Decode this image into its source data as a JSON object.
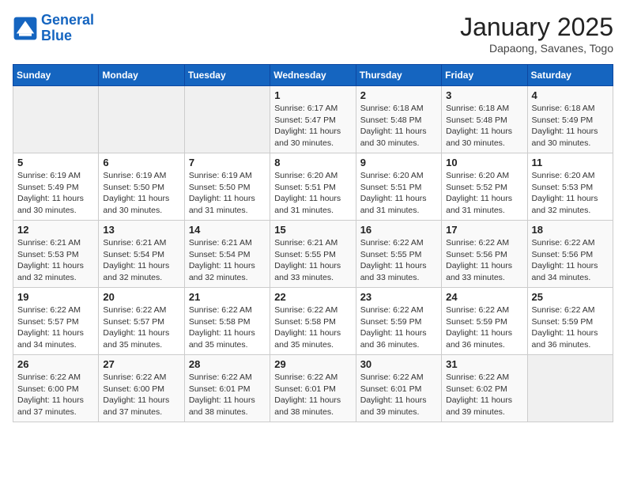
{
  "logo": {
    "line1": "General",
    "line2": "Blue"
  },
  "title": "January 2025",
  "subtitle": "Dapaong, Savanes, Togo",
  "weekdays": [
    "Sunday",
    "Monday",
    "Tuesday",
    "Wednesday",
    "Thursday",
    "Friday",
    "Saturday"
  ],
  "weeks": [
    [
      {
        "day": "",
        "detail": ""
      },
      {
        "day": "",
        "detail": ""
      },
      {
        "day": "",
        "detail": ""
      },
      {
        "day": "1",
        "detail": "Sunrise: 6:17 AM\nSunset: 5:47 PM\nDaylight: 11 hours and 30 minutes."
      },
      {
        "day": "2",
        "detail": "Sunrise: 6:18 AM\nSunset: 5:48 PM\nDaylight: 11 hours and 30 minutes."
      },
      {
        "day": "3",
        "detail": "Sunrise: 6:18 AM\nSunset: 5:48 PM\nDaylight: 11 hours and 30 minutes."
      },
      {
        "day": "4",
        "detail": "Sunrise: 6:18 AM\nSunset: 5:49 PM\nDaylight: 11 hours and 30 minutes."
      }
    ],
    [
      {
        "day": "5",
        "detail": "Sunrise: 6:19 AM\nSunset: 5:49 PM\nDaylight: 11 hours and 30 minutes."
      },
      {
        "day": "6",
        "detail": "Sunrise: 6:19 AM\nSunset: 5:50 PM\nDaylight: 11 hours and 30 minutes."
      },
      {
        "day": "7",
        "detail": "Sunrise: 6:19 AM\nSunset: 5:50 PM\nDaylight: 11 hours and 31 minutes."
      },
      {
        "day": "8",
        "detail": "Sunrise: 6:20 AM\nSunset: 5:51 PM\nDaylight: 11 hours and 31 minutes."
      },
      {
        "day": "9",
        "detail": "Sunrise: 6:20 AM\nSunset: 5:51 PM\nDaylight: 11 hours and 31 minutes."
      },
      {
        "day": "10",
        "detail": "Sunrise: 6:20 AM\nSunset: 5:52 PM\nDaylight: 11 hours and 31 minutes."
      },
      {
        "day": "11",
        "detail": "Sunrise: 6:20 AM\nSunset: 5:53 PM\nDaylight: 11 hours and 32 minutes."
      }
    ],
    [
      {
        "day": "12",
        "detail": "Sunrise: 6:21 AM\nSunset: 5:53 PM\nDaylight: 11 hours and 32 minutes."
      },
      {
        "day": "13",
        "detail": "Sunrise: 6:21 AM\nSunset: 5:54 PM\nDaylight: 11 hours and 32 minutes."
      },
      {
        "day": "14",
        "detail": "Sunrise: 6:21 AM\nSunset: 5:54 PM\nDaylight: 11 hours and 32 minutes."
      },
      {
        "day": "15",
        "detail": "Sunrise: 6:21 AM\nSunset: 5:55 PM\nDaylight: 11 hours and 33 minutes."
      },
      {
        "day": "16",
        "detail": "Sunrise: 6:22 AM\nSunset: 5:55 PM\nDaylight: 11 hours and 33 minutes."
      },
      {
        "day": "17",
        "detail": "Sunrise: 6:22 AM\nSunset: 5:56 PM\nDaylight: 11 hours and 33 minutes."
      },
      {
        "day": "18",
        "detail": "Sunrise: 6:22 AM\nSunset: 5:56 PM\nDaylight: 11 hours and 34 minutes."
      }
    ],
    [
      {
        "day": "19",
        "detail": "Sunrise: 6:22 AM\nSunset: 5:57 PM\nDaylight: 11 hours and 34 minutes."
      },
      {
        "day": "20",
        "detail": "Sunrise: 6:22 AM\nSunset: 5:57 PM\nDaylight: 11 hours and 35 minutes."
      },
      {
        "day": "21",
        "detail": "Sunrise: 6:22 AM\nSunset: 5:58 PM\nDaylight: 11 hours and 35 minutes."
      },
      {
        "day": "22",
        "detail": "Sunrise: 6:22 AM\nSunset: 5:58 PM\nDaylight: 11 hours and 35 minutes."
      },
      {
        "day": "23",
        "detail": "Sunrise: 6:22 AM\nSunset: 5:59 PM\nDaylight: 11 hours and 36 minutes."
      },
      {
        "day": "24",
        "detail": "Sunrise: 6:22 AM\nSunset: 5:59 PM\nDaylight: 11 hours and 36 minutes."
      },
      {
        "day": "25",
        "detail": "Sunrise: 6:22 AM\nSunset: 5:59 PM\nDaylight: 11 hours and 36 minutes."
      }
    ],
    [
      {
        "day": "26",
        "detail": "Sunrise: 6:22 AM\nSunset: 6:00 PM\nDaylight: 11 hours and 37 minutes."
      },
      {
        "day": "27",
        "detail": "Sunrise: 6:22 AM\nSunset: 6:00 PM\nDaylight: 11 hours and 37 minutes."
      },
      {
        "day": "28",
        "detail": "Sunrise: 6:22 AM\nSunset: 6:01 PM\nDaylight: 11 hours and 38 minutes."
      },
      {
        "day": "29",
        "detail": "Sunrise: 6:22 AM\nSunset: 6:01 PM\nDaylight: 11 hours and 38 minutes."
      },
      {
        "day": "30",
        "detail": "Sunrise: 6:22 AM\nSunset: 6:01 PM\nDaylight: 11 hours and 39 minutes."
      },
      {
        "day": "31",
        "detail": "Sunrise: 6:22 AM\nSunset: 6:02 PM\nDaylight: 11 hours and 39 minutes."
      },
      {
        "day": "",
        "detail": ""
      }
    ]
  ]
}
